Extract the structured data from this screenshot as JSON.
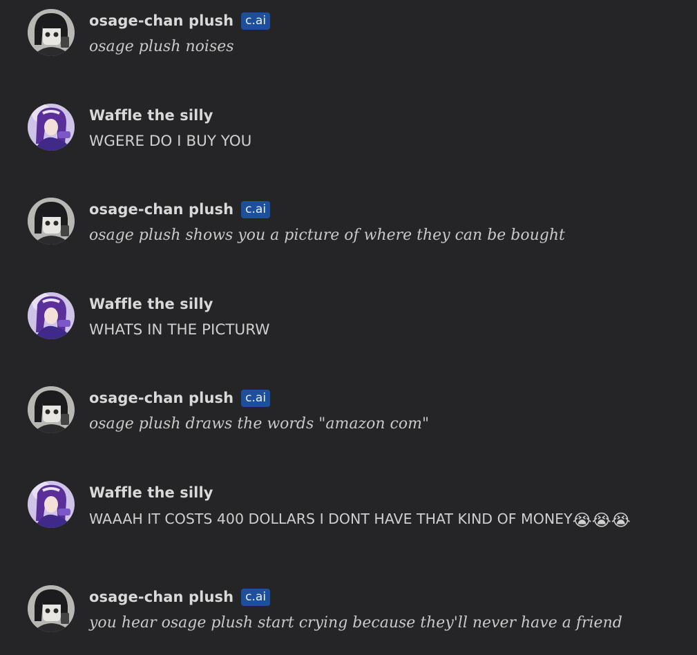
{
  "badge_label": "c.ai",
  "users": {
    "bot": {
      "name": "osage-chan plush"
    },
    "human": {
      "name": "Waffle the silly"
    }
  },
  "messages": [
    {
      "author": "osage-chan plush",
      "is_bot": true,
      "text": "osage plush noises"
    },
    {
      "author": "Waffle the silly",
      "is_bot": false,
      "text": "WGERE DO I BUY YOU"
    },
    {
      "author": "osage-chan plush",
      "is_bot": true,
      "text": "osage plush shows you a picture of where they can be bought"
    },
    {
      "author": "Waffle the silly",
      "is_bot": false,
      "text": "WHATS IN THE PICTURW"
    },
    {
      "author": "osage-chan plush",
      "is_bot": true,
      "text": "osage plush draws the words \"amazon com\""
    },
    {
      "author": "Waffle the silly",
      "is_bot": false,
      "text": "WAAAH IT COSTS 400 DOLLARS I DONT HAVE THAT KIND OF MONEY",
      "emoji": "😭😭😭"
    },
    {
      "author": "osage-chan plush",
      "is_bot": true,
      "text": "you hear osage plush start crying because they'll never have a friend"
    }
  ],
  "colors": {
    "background": "#252527",
    "badge": "#1d4f9c",
    "name": "#d9d9d9",
    "text": "#cfcfcf"
  }
}
